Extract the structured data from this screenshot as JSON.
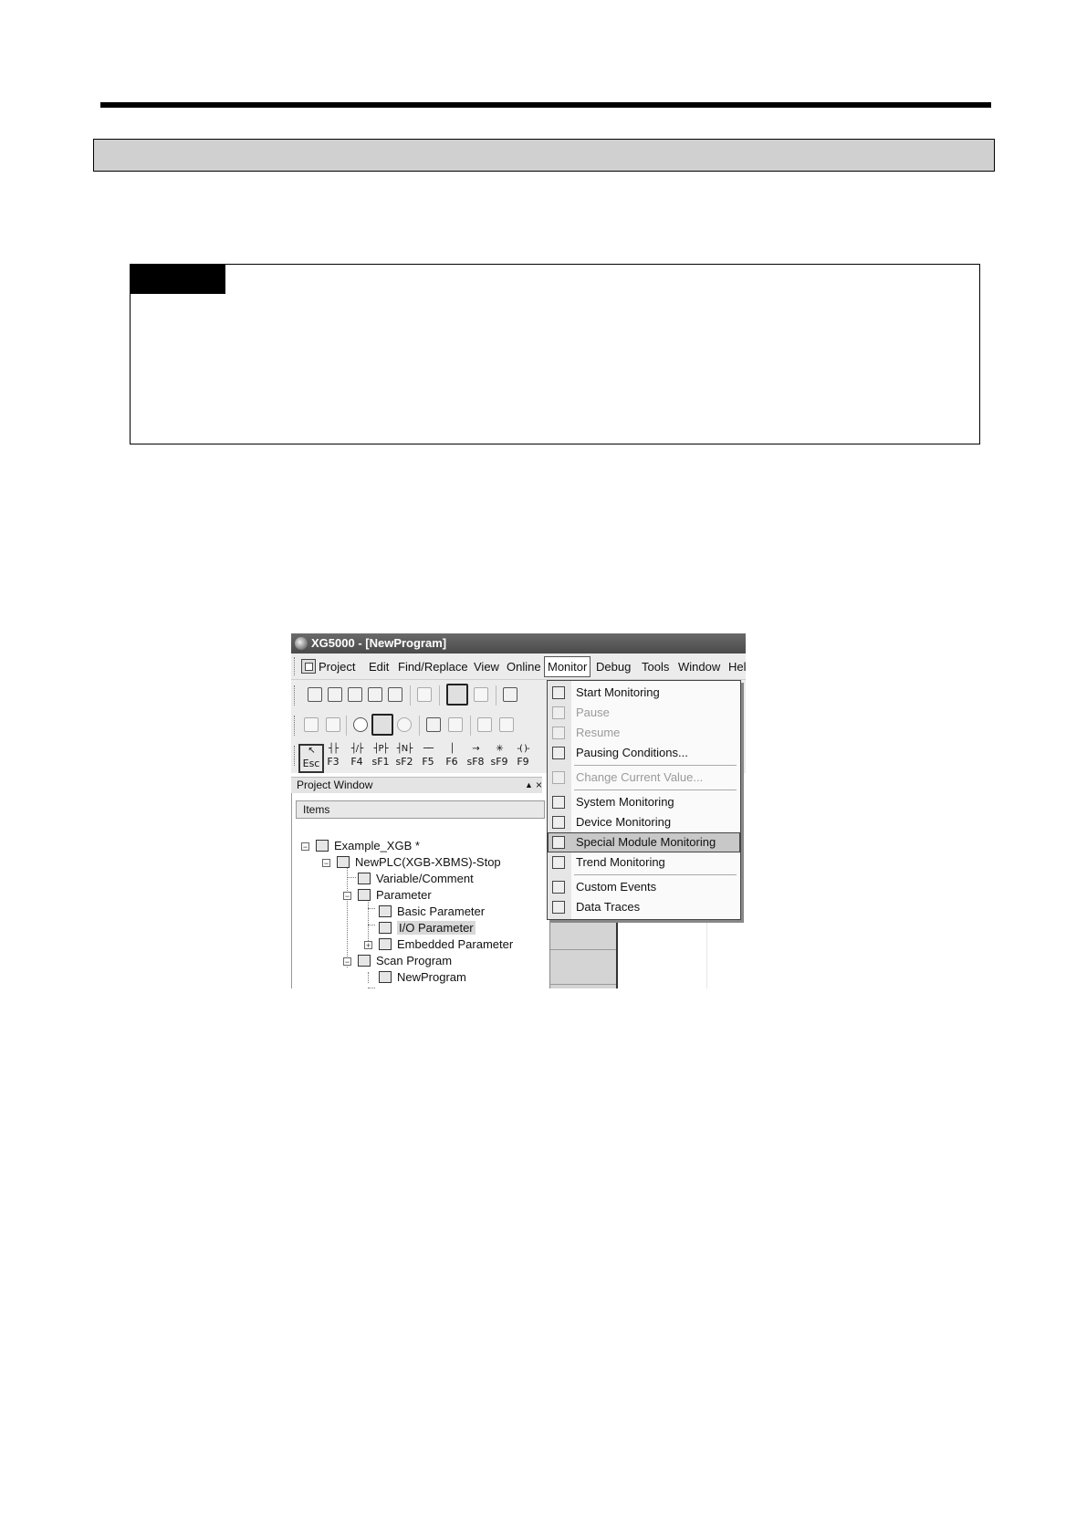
{
  "app": {
    "title": "XG5000 - [NewProgram]"
  },
  "menubar": {
    "items": [
      {
        "label": "Project"
      },
      {
        "label": "Edit"
      },
      {
        "label": "Find/Replace"
      },
      {
        "label": "View"
      },
      {
        "label": "Online"
      },
      {
        "label": "Monitor"
      },
      {
        "label": "Debug"
      },
      {
        "label": "Tools"
      },
      {
        "label": "Window"
      },
      {
        "label": "Help"
      }
    ],
    "open_menu": "Monitor"
  },
  "function_keys": {
    "labels": [
      "Esc",
      "F3",
      "F4",
      "sF1",
      "sF2",
      "F5",
      "F6",
      "sF8",
      "sF9",
      "F9"
    ]
  },
  "project_window": {
    "title": "Project Window",
    "pin_glyph": "▲",
    "close_glyph": "×",
    "column_header": "Items",
    "tree": [
      {
        "label": "Example_XGB *"
      },
      {
        "label": "NewPLC(XGB-XBMS)-Stop"
      },
      {
        "label": "Variable/Comment"
      },
      {
        "label": "Parameter"
      },
      {
        "label": "Basic Parameter"
      },
      {
        "label": "I/O Parameter",
        "selected": true
      },
      {
        "label": "Embedded Parameter"
      },
      {
        "label": "Scan Program"
      },
      {
        "label": "NewProgram"
      }
    ]
  },
  "monitor_menu": {
    "items": [
      {
        "label": "Start Monitoring",
        "enabled": true
      },
      {
        "label": "Pause",
        "enabled": false
      },
      {
        "label": "Resume",
        "enabled": false
      },
      {
        "label": "Pausing Conditions...",
        "enabled": true
      },
      {
        "label": "Change Current Value...",
        "enabled": false
      },
      {
        "label": "System Monitoring",
        "enabled": true
      },
      {
        "label": "Device Monitoring",
        "enabled": true
      },
      {
        "label": "Special Module Monitoring",
        "enabled": true,
        "highlighted": true
      },
      {
        "label": "Trend Monitoring",
        "enabled": true
      },
      {
        "label": "Custom Events",
        "enabled": true
      },
      {
        "label": "Data Traces",
        "enabled": true
      }
    ]
  },
  "icons": {
    "app": "xg5000-app-icon",
    "toolbar": [
      "new-file-icon",
      "open-folder-icon",
      "open-project-icon",
      "save-icon",
      "print-icon",
      "comment-icon",
      "connect-icon",
      "disconnect-icon",
      "plc-info-icon",
      "run-icon",
      "stop-icon",
      "pause-icon",
      "write-icon",
      "read-icon",
      "compile-icon",
      "compile-all-icon"
    ]
  }
}
